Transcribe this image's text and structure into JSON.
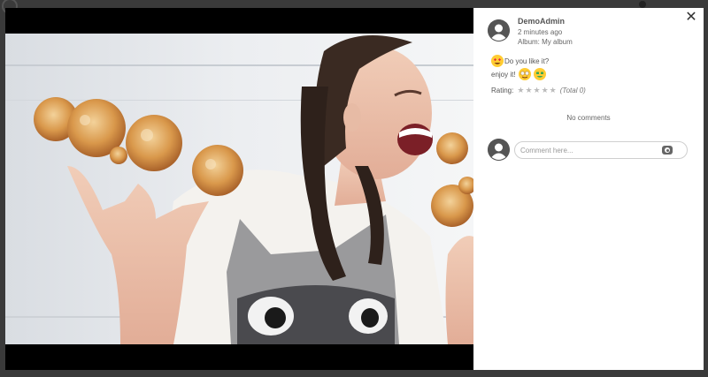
{
  "post": {
    "author": "DemoAdmin",
    "time": "2 minutes ago",
    "album": "Album: My album",
    "description_line1": "Do you like it?",
    "description_line2": "enjoy it!",
    "emojis": [
      "heart-eyes-emoji",
      "star-struck-emoji",
      "money-mouth-emoji"
    ]
  },
  "rating": {
    "label": "Rating:",
    "stars": 0,
    "max_stars": 5,
    "total": "(Total 0)"
  },
  "comments": {
    "empty_text": "No comments",
    "placeholder": "Comment here..."
  },
  "icons": {
    "close": "close-icon",
    "camera": "camera-icon",
    "avatar": "user-avatar-icon"
  },
  "colors": {
    "panel": "#ffffff",
    "backdrop": "#000000",
    "text": "#555555"
  }
}
